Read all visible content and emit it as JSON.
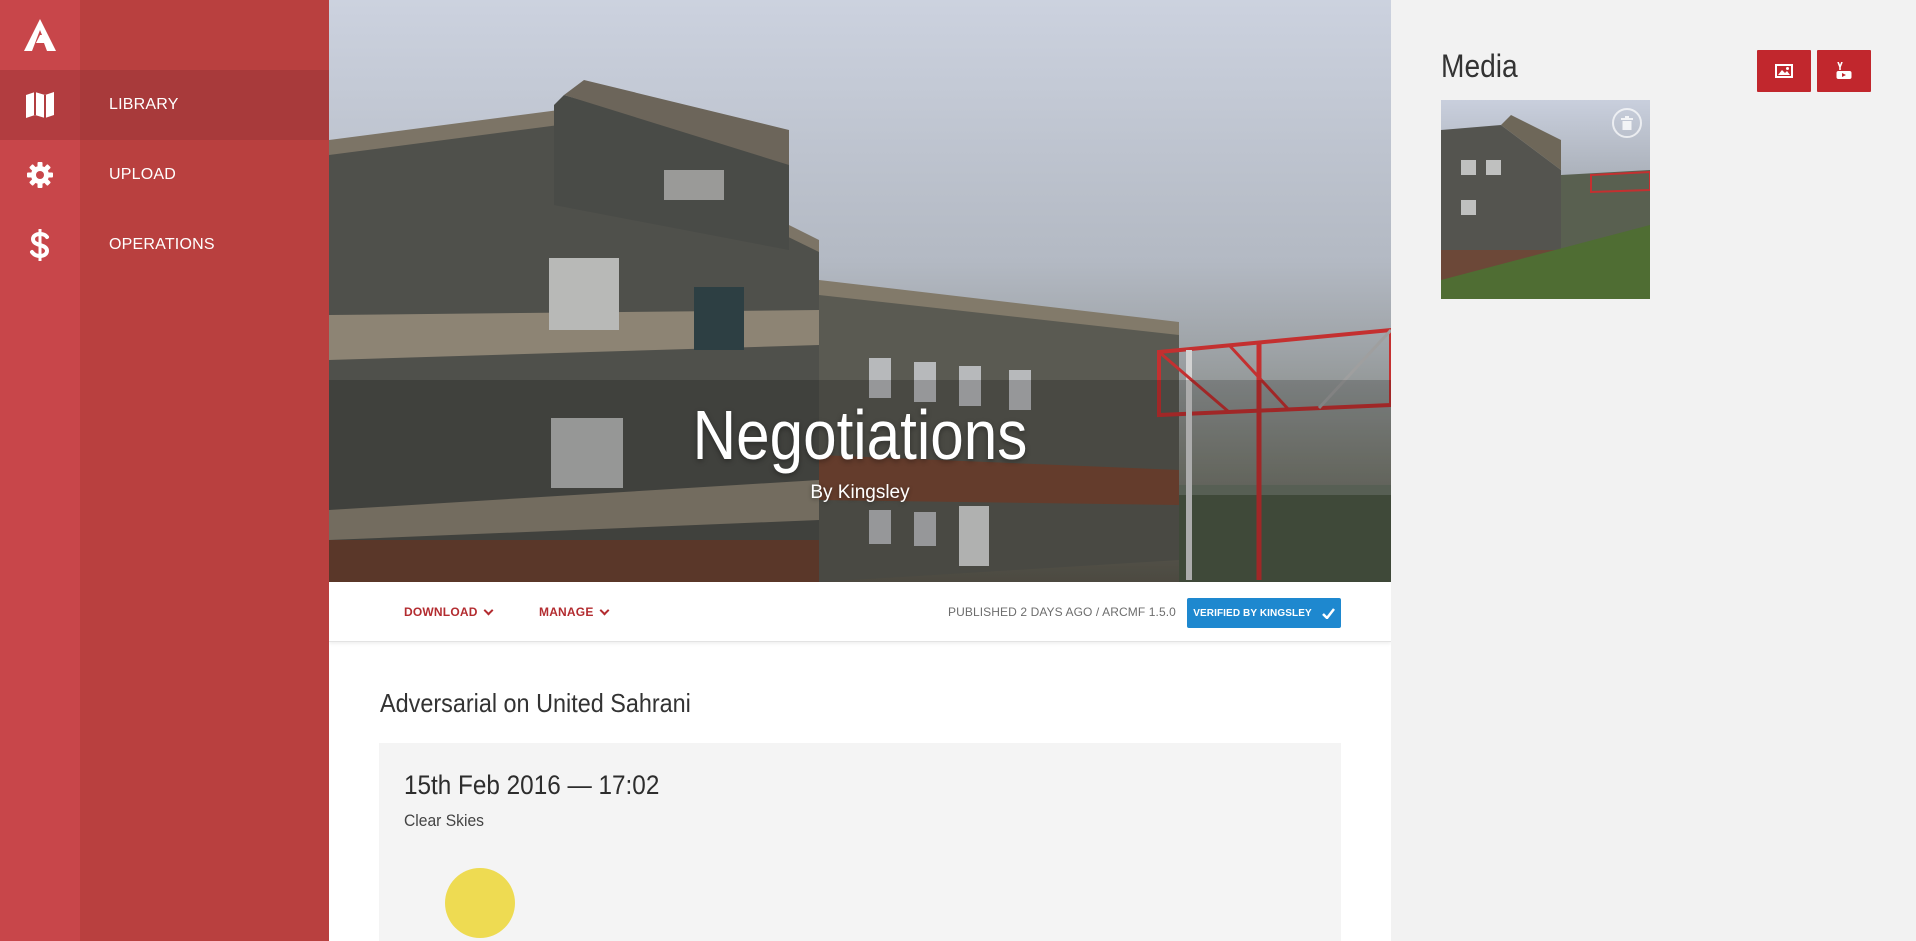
{
  "sidebar": {
    "logo": "arma-logo-icon",
    "items": [
      {
        "label": "LIBRARY",
        "icon": "map-icon",
        "active": true
      },
      {
        "label": "UPLOAD",
        "icon": "gear-icon",
        "active": false
      },
      {
        "label": "OPERATIONS",
        "icon": "dollar-icon",
        "active": false
      }
    ]
  },
  "mission": {
    "title": "Negotiations",
    "author": "By Kingsley",
    "subtitle": "Adversarial on United Sahrani",
    "date": "15th Feb 2016 — 17:02",
    "weather": "Clear Skies"
  },
  "toolbar": {
    "download_label": "DOWNLOAD",
    "manage_label": "MANAGE",
    "published": "PUBLISHED 2 DAYS AGO / ARCMF 1.5.0",
    "verified": "VERIFIED BY KINGSLEY"
  },
  "media": {
    "title": "Media",
    "buttons": [
      {
        "icon": "image-icon"
      },
      {
        "icon": "youtube-icon"
      }
    ]
  },
  "colors": {
    "rail": "#c8464a",
    "nav": "#b9403f",
    "accent": "#c1272d",
    "verified": "#1e88cf",
    "sun": "#eedb52"
  }
}
